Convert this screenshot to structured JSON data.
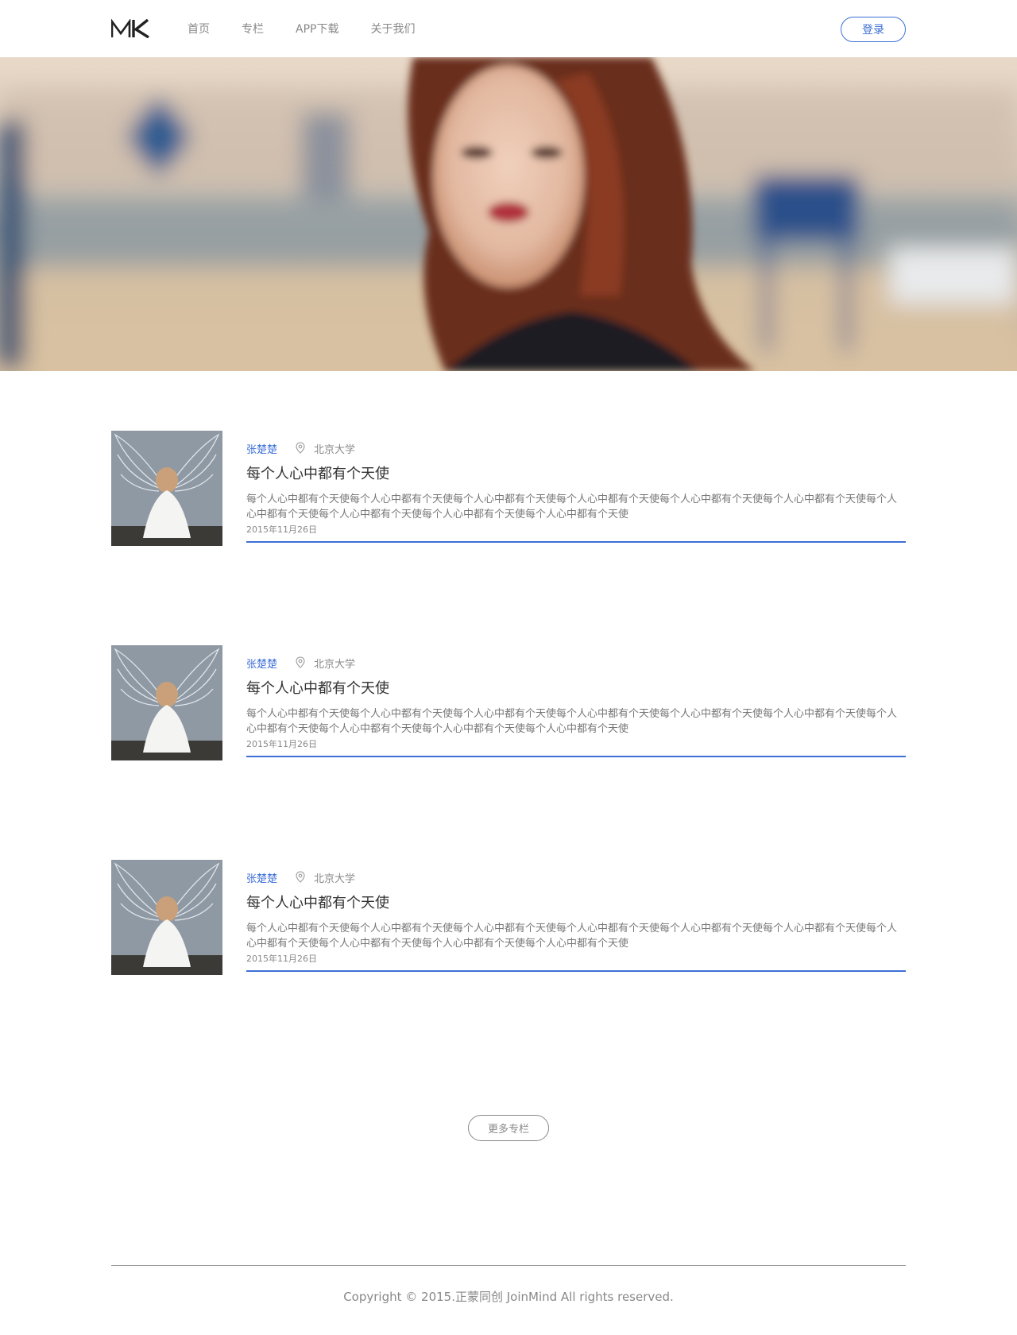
{
  "header": {
    "logo_text": "MK",
    "nav": [
      "首页",
      "专栏",
      "APP下载",
      "关于我们"
    ],
    "login_label": "登录"
  },
  "colors": {
    "accent": "#3d6fd6",
    "text": "#333333",
    "muted": "#888888"
  },
  "articles": [
    {
      "author": "张楚楚",
      "location_icon": "location-pin-icon",
      "school": "北京大学",
      "title": "每个人心中都有个天使",
      "body": "每个人心中都有个天使每个人心中都有个天使每个人心中都有个天使每个人心中都有个天使每个人心中都有个天使每个人心中都有个天使每个人心中都有个天使每个人心中都有个天使每个人心中都有个天使每个人心中都有个天使",
      "date": "2015年11月26日"
    },
    {
      "author": "张楚楚",
      "location_icon": "location-pin-icon",
      "school": "北京大学",
      "title": "每个人心中都有个天使",
      "body": "每个人心中都有个天使每个人心中都有个天使每个人心中都有个天使每个人心中都有个天使每个人心中都有个天使每个人心中都有个天使每个人心中都有个天使每个人心中都有个天使每个人心中都有个天使每个人心中都有个天使",
      "date": "2015年11月26日"
    },
    {
      "author": "张楚楚",
      "location_icon": "location-pin-icon",
      "school": "北京大学",
      "title": "每个人心中都有个天使",
      "body": "每个人心中都有个天使每个人心中都有个天使每个人心中都有个天使每个人心中都有个天使每个人心中都有个天使每个人心中都有个天使每个人心中都有个天使每个人心中都有个天使每个人心中都有个天使每个人心中都有个天使",
      "date": "2015年11月26日"
    }
  ],
  "more_label": "更多专栏",
  "footer": {
    "copyright": "Copyright © 2015.正蒙同创 JoinMind All rights reserved."
  }
}
